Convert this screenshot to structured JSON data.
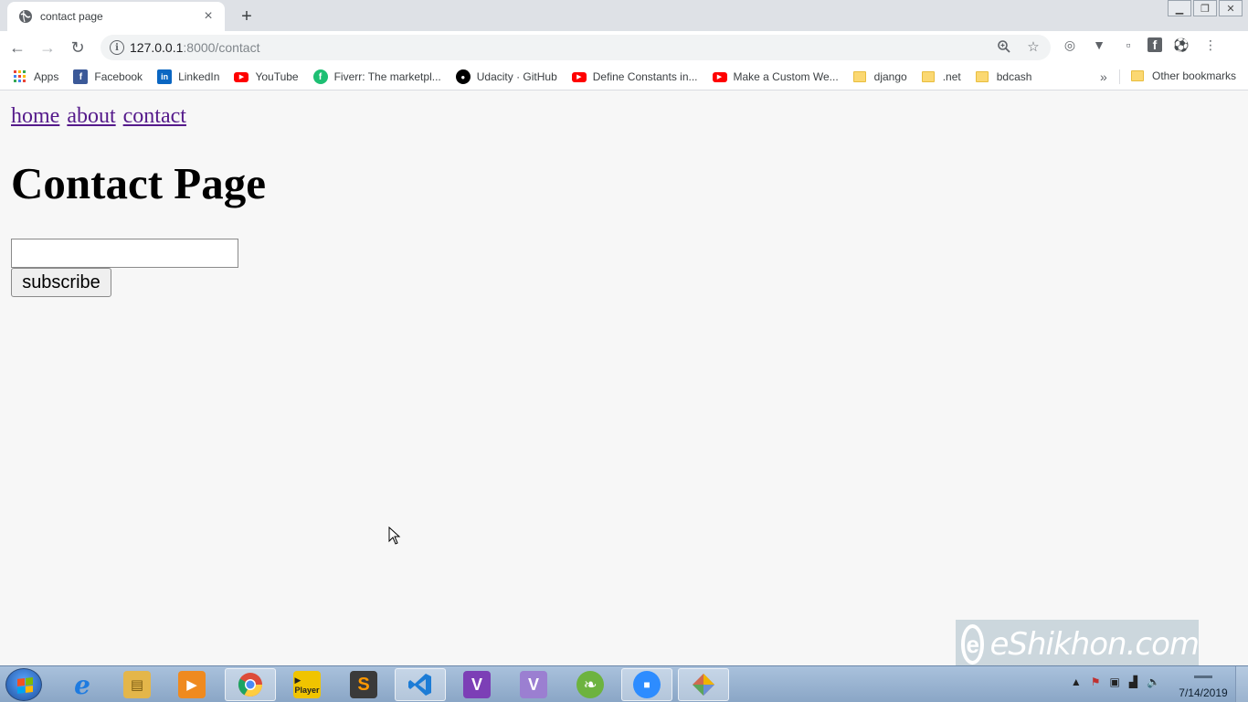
{
  "browser": {
    "tab": {
      "title": "contact page",
      "favicon": "globe-icon",
      "close_icon": "close-icon"
    },
    "new_tab_icon": "plus-icon",
    "window_controls": [
      "minimize-icon",
      "restore-icon",
      "close-icon"
    ],
    "address": {
      "host": "127.0.0.1",
      "path": ":8000/contact"
    },
    "omnibox_icons": [
      "info-icon",
      "zoom-icon",
      "star-icon"
    ],
    "extension_icons": [
      "extension-icon",
      "vpn-icon",
      "blank-extension-icon",
      "facebook-icon",
      "soccer-icon",
      "menu-icon"
    ]
  },
  "bookmarks": {
    "items": [
      {
        "label": "Apps",
        "icon": "apps-grid-icon"
      },
      {
        "label": "Facebook",
        "icon": "facebook-icon",
        "color": "#3b5998",
        "glyph": "f"
      },
      {
        "label": "LinkedIn",
        "icon": "linkedin-icon",
        "color": "#0a66c2",
        "glyph": "in"
      },
      {
        "label": "YouTube",
        "icon": "youtube-icon",
        "color": "#ff0000",
        "glyph": "▶"
      },
      {
        "label": "Fiverr: The marketpl...",
        "icon": "fiverr-icon",
        "color": "#1dbf73",
        "glyph": "f"
      },
      {
        "label": "Udacity · GitHub",
        "icon": "github-icon",
        "color": "#000000",
        "glyph": "●"
      },
      {
        "label": "Define Constants in...",
        "icon": "youtube-icon",
        "color": "#ff0000",
        "glyph": "▶"
      },
      {
        "label": "Make a Custom We...",
        "icon": "youtube-icon",
        "color": "#ff0000",
        "glyph": "▶"
      }
    ],
    "folders": [
      "django",
      ".net",
      "bdcash"
    ],
    "more_label": "»",
    "other_label": "Other bookmarks"
  },
  "page": {
    "nav": {
      "home": "home",
      "about": "about",
      "contact": "contact"
    },
    "heading": "Contact Page",
    "email_input": {
      "value": "",
      "placeholder": ""
    },
    "subscribe_label": "subscribe"
  },
  "watermark": {
    "text": "eShikhon.com"
  },
  "taskbar": {
    "apps": [
      {
        "name": "internet-explorer-icon",
        "glyph": "e",
        "color": "#1e7be0"
      },
      {
        "name": "file-explorer-icon",
        "glyph": "▤",
        "color": "#e4b64a"
      },
      {
        "name": "media-player-icon",
        "glyph": "▶",
        "color": "#ef8a1f"
      },
      {
        "name": "chrome-icon",
        "glyph": "●",
        "color": "#dd4b39"
      },
      {
        "name": "kmplayer-icon",
        "glyph": "▶",
        "color": "#f0c400"
      },
      {
        "name": "sublime-text-icon",
        "glyph": "S",
        "color": "#ff7b00"
      },
      {
        "name": "vscode-icon",
        "glyph": "⟩",
        "color": "#1c7cd6"
      },
      {
        "name": "visual-studio-icon",
        "glyph": "V",
        "color": "#7c3fb6"
      },
      {
        "name": "visual-studio-2-icon",
        "glyph": "V",
        "color": "#9b7fd1"
      },
      {
        "name": "spring-icon",
        "glyph": "❧",
        "color": "#6db33f"
      },
      {
        "name": "zoom-icon",
        "glyph": "■",
        "color": "#2d8cff"
      },
      {
        "name": "kite-icon",
        "glyph": "◆",
        "color": "#d06a4f"
      }
    ],
    "tray_icons": [
      "show-hidden-icon",
      "flag-icon",
      "network-device-icon",
      "signal-icon",
      "volume-icon"
    ],
    "date": "7/14/2019"
  }
}
